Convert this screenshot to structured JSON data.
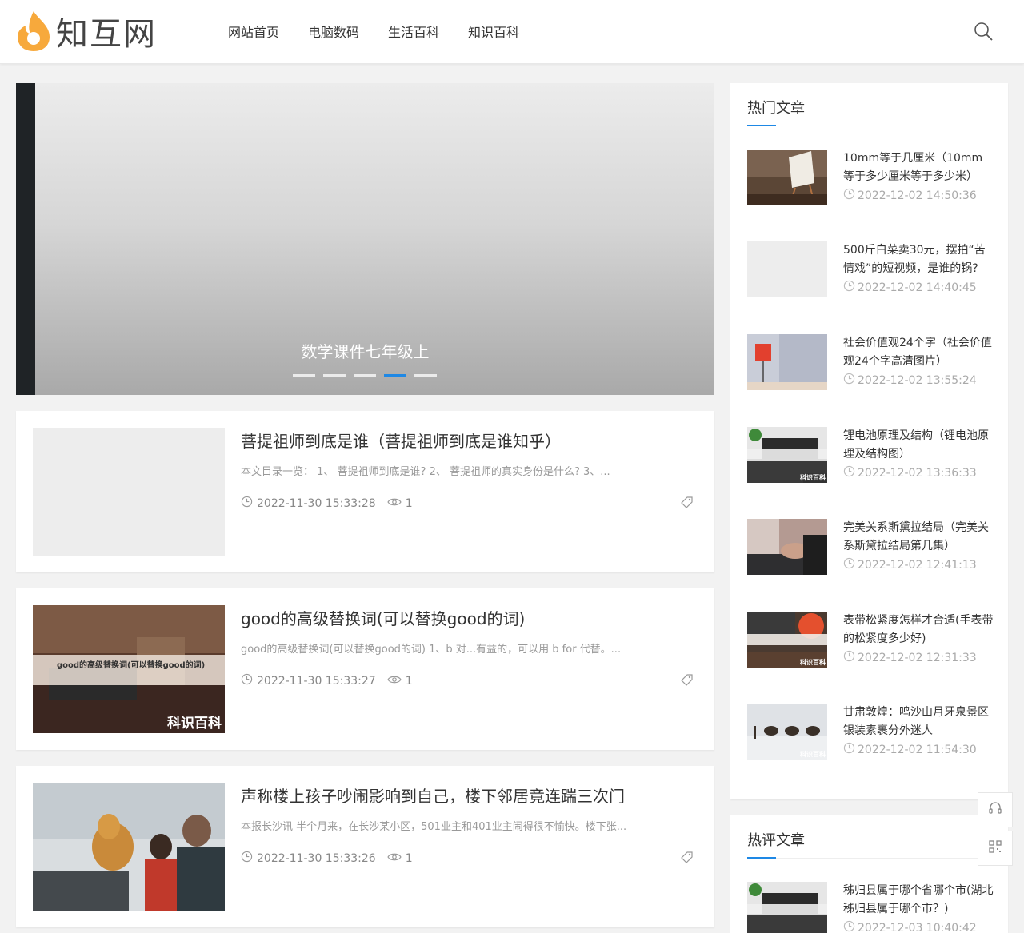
{
  "site": {
    "name": "知互网",
    "brand_color": "#f7a93c",
    "accent_color": "#1e88e5"
  },
  "nav": [
    "网站首页",
    "电脑数码",
    "生活百科",
    "知识百科"
  ],
  "slider": {
    "caption": "数学课件七年级上",
    "active_index": 3,
    "dot_count": 5
  },
  "posts": [
    {
      "title": "菩提祖师到底是谁（菩提祖师到底是谁知乎）",
      "excerpt": "本文目录一览： 1、 菩提祖师到底是谁? 2、 菩提祖师的真实身份是什么? 3、...",
      "date": "2022-11-30 15:33:28",
      "views": "1"
    },
    {
      "title": "good的高级替换词(可以替换good的词)",
      "excerpt": "good的高级替换词(可以替换good的词) 1、b 对...有益的，可以用 b for 代替。...",
      "date": "2022-11-30 15:33:27",
      "views": "1",
      "thumb_overlay": "good的高级替换词(可以替换good的词)",
      "thumb_badge": "科识百科"
    },
    {
      "title": "声称楼上孩子吵闹影响到自己，楼下邻居竟连踹三次门",
      "excerpt": "本报长沙讯 半个月来，在长沙某小区，501业主和401业主闹得很不愉快。楼下张...",
      "date": "2022-11-30 15:33:26",
      "views": "1"
    }
  ],
  "hot_articles": {
    "title": "热门文章",
    "items": [
      {
        "title": "10mm等于几厘米（10mm等于多少厘米等于多少米）",
        "date": "2022-12-02 14:50:36"
      },
      {
        "title": "500斤白菜卖30元，摆拍“苦情戏”的短视频，是谁的锅?",
        "date": "2022-12-02 14:40:45"
      },
      {
        "title": "社会价值观24个字（社会价值观24个字高清图片）",
        "date": "2022-12-02 13:55:24"
      },
      {
        "title": "锂电池原理及结构（锂电池原理及结构图）",
        "date": "2022-12-02 13:36:33"
      },
      {
        "title": "完美关系斯黛拉结局（完美关系斯黛拉结局第几集）",
        "date": "2022-12-02 12:41:13"
      },
      {
        "title": "表带松紧度怎样才合适(手表带的松紧度多少好)",
        "date": "2022-12-02 12:31:33"
      },
      {
        "title": "甘肃敦煌：鸣沙山月牙泉景区银装素裹分外迷人",
        "date": "2022-12-02 11:54:30"
      }
    ]
  },
  "hot_comments": {
    "title": "热评文章",
    "items": [
      {
        "title": "秭归县属于哪个省哪个市(湖北秭归县属于哪个市？)",
        "date": "2022-12-03 10:40:42"
      }
    ]
  },
  "thumb_badge": "科识百科"
}
